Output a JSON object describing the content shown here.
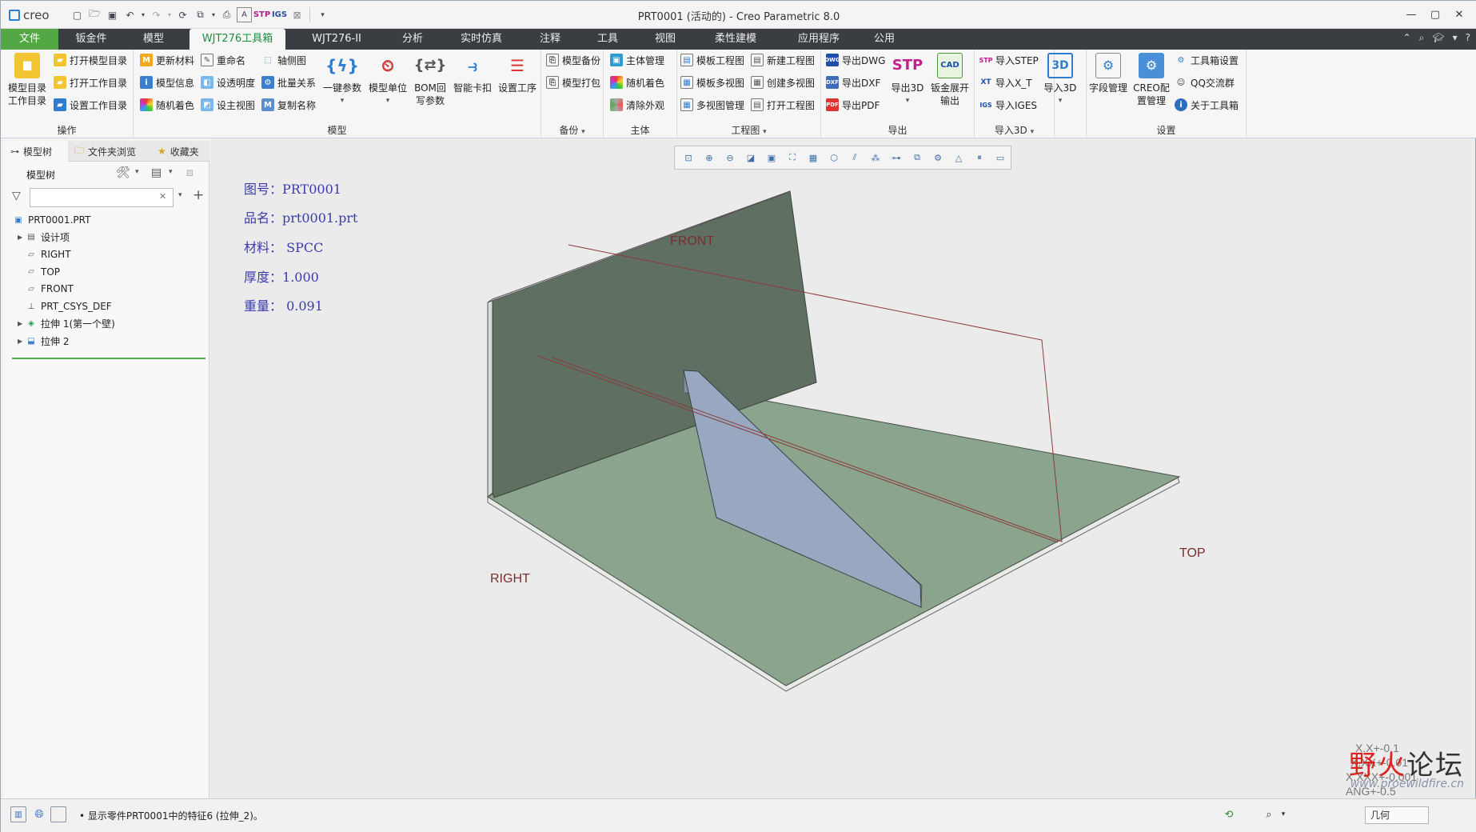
{
  "app": {
    "logo_text": "creo",
    "window_title": "PRT0001 (活动的) - Creo Parametric 8.0"
  },
  "tabs": [
    "文件",
    "钣金件",
    "模型",
    "WJT276工具箱",
    "WJT276-II",
    "分析",
    "实时仿真",
    "注释",
    "工具",
    "视图",
    "柔性建模",
    "应用程序",
    "公用"
  ],
  "active_tab": "WJT276工具箱",
  "ribbon": {
    "ops": {
      "label": "操作",
      "big": "模型目录\n工作目录",
      "items": [
        "打开模型目录",
        "打开工作目录",
        "设置工作目录"
      ]
    },
    "model": {
      "label": "模型",
      "col1": [
        "更新材料",
        "模型信息",
        "随机着色"
      ],
      "col2": [
        "重命名",
        "设透明度",
        "设主视图"
      ],
      "col3": [
        "轴侧图",
        "批量关系",
        "复制名称"
      ],
      "big": [
        "一键参数",
        "模型单位",
        "BOM回\n写参数",
        "智能卡扣",
        "设置工序"
      ]
    },
    "backup": {
      "label": "备份",
      "items": [
        "模型备份",
        "模型打包"
      ]
    },
    "body": {
      "label": "主体",
      "items": [
        "主体管理",
        "随机着色",
        "清除外观"
      ]
    },
    "drawing": {
      "label": "工程图",
      "col1": [
        "模板工程图",
        "模板多视图",
        "多视图管理"
      ],
      "col2": [
        "新建工程图",
        "创建多视图",
        "打开工程图"
      ]
    },
    "export": {
      "label": "导出",
      "items": [
        "导出DWG",
        "导出DXF",
        "导出PDF"
      ],
      "big": [
        "导出3D",
        "钣金展开\n输出"
      ]
    },
    "import": {
      "label": "导入3D",
      "items": [
        "导入STEP",
        "导入X_T",
        "导入IGES"
      ],
      "big": "导入3D"
    },
    "settings": {
      "label": "设置",
      "big": [
        "字段管理",
        "CREO配\n置管理"
      ],
      "items": [
        "工具箱设置",
        "QQ交流群",
        "关于工具箱"
      ]
    }
  },
  "nav": {
    "tabs": [
      "模型树",
      "文件夹浏览",
      "收藏夹"
    ],
    "tree_header": "模型树",
    "search_placeholder": "",
    "tree": [
      {
        "label": "PRT0001.PRT",
        "icon": "part-icon",
        "expander": false,
        "indent": 0
      },
      {
        "label": "设计项",
        "icon": "design-items-icon",
        "expander": true,
        "indent": 1
      },
      {
        "label": "RIGHT",
        "icon": "datum-plane-icon",
        "expander": false,
        "indent": 1
      },
      {
        "label": "TOP",
        "icon": "datum-plane-icon",
        "expander": false,
        "indent": 1
      },
      {
        "label": "FRONT",
        "icon": "datum-plane-icon",
        "expander": false,
        "indent": 1
      },
      {
        "label": "PRT_CSYS_DEF",
        "icon": "csys-icon",
        "expander": false,
        "indent": 1
      },
      {
        "label": "拉伸 1(第一个壁)",
        "icon": "sheetmetal-wall-icon",
        "expander": true,
        "indent": 1
      },
      {
        "label": "拉伸 2",
        "icon": "extrude-icon",
        "expander": true,
        "indent": 1
      }
    ]
  },
  "info": [
    {
      "label": "图号：",
      "value": "PRT0001"
    },
    {
      "label": "品名：",
      "value": "prt0001.prt"
    },
    {
      "label": "材料：",
      "value": " SPCC"
    },
    {
      "label": "厚度：",
      "value": "1.000"
    },
    {
      "label": "重量：",
      "value": " 0.091"
    }
  ],
  "datums": {
    "front": "FRONT",
    "right": "RIGHT",
    "top": "TOP"
  },
  "tolerances": [
    "X.X+-0.1",
    "X.XX+-0.01",
    "X.XXX+-0.001",
    "ANG+-0.5"
  ],
  "watermark": {
    "title_red": "野火",
    "title_black": "论坛",
    "url": "www.proewildfire.cn"
  },
  "status": {
    "message": "• 显示零件PRT0001中的特征6 (拉伸_2)。",
    "filter": "几何"
  },
  "colors": {
    "accent_green": "#53a845",
    "tab_bar": "#3a3d42",
    "wall": "#5f6f61",
    "base": "#8ba48d",
    "rib": "#98a8c0"
  }
}
